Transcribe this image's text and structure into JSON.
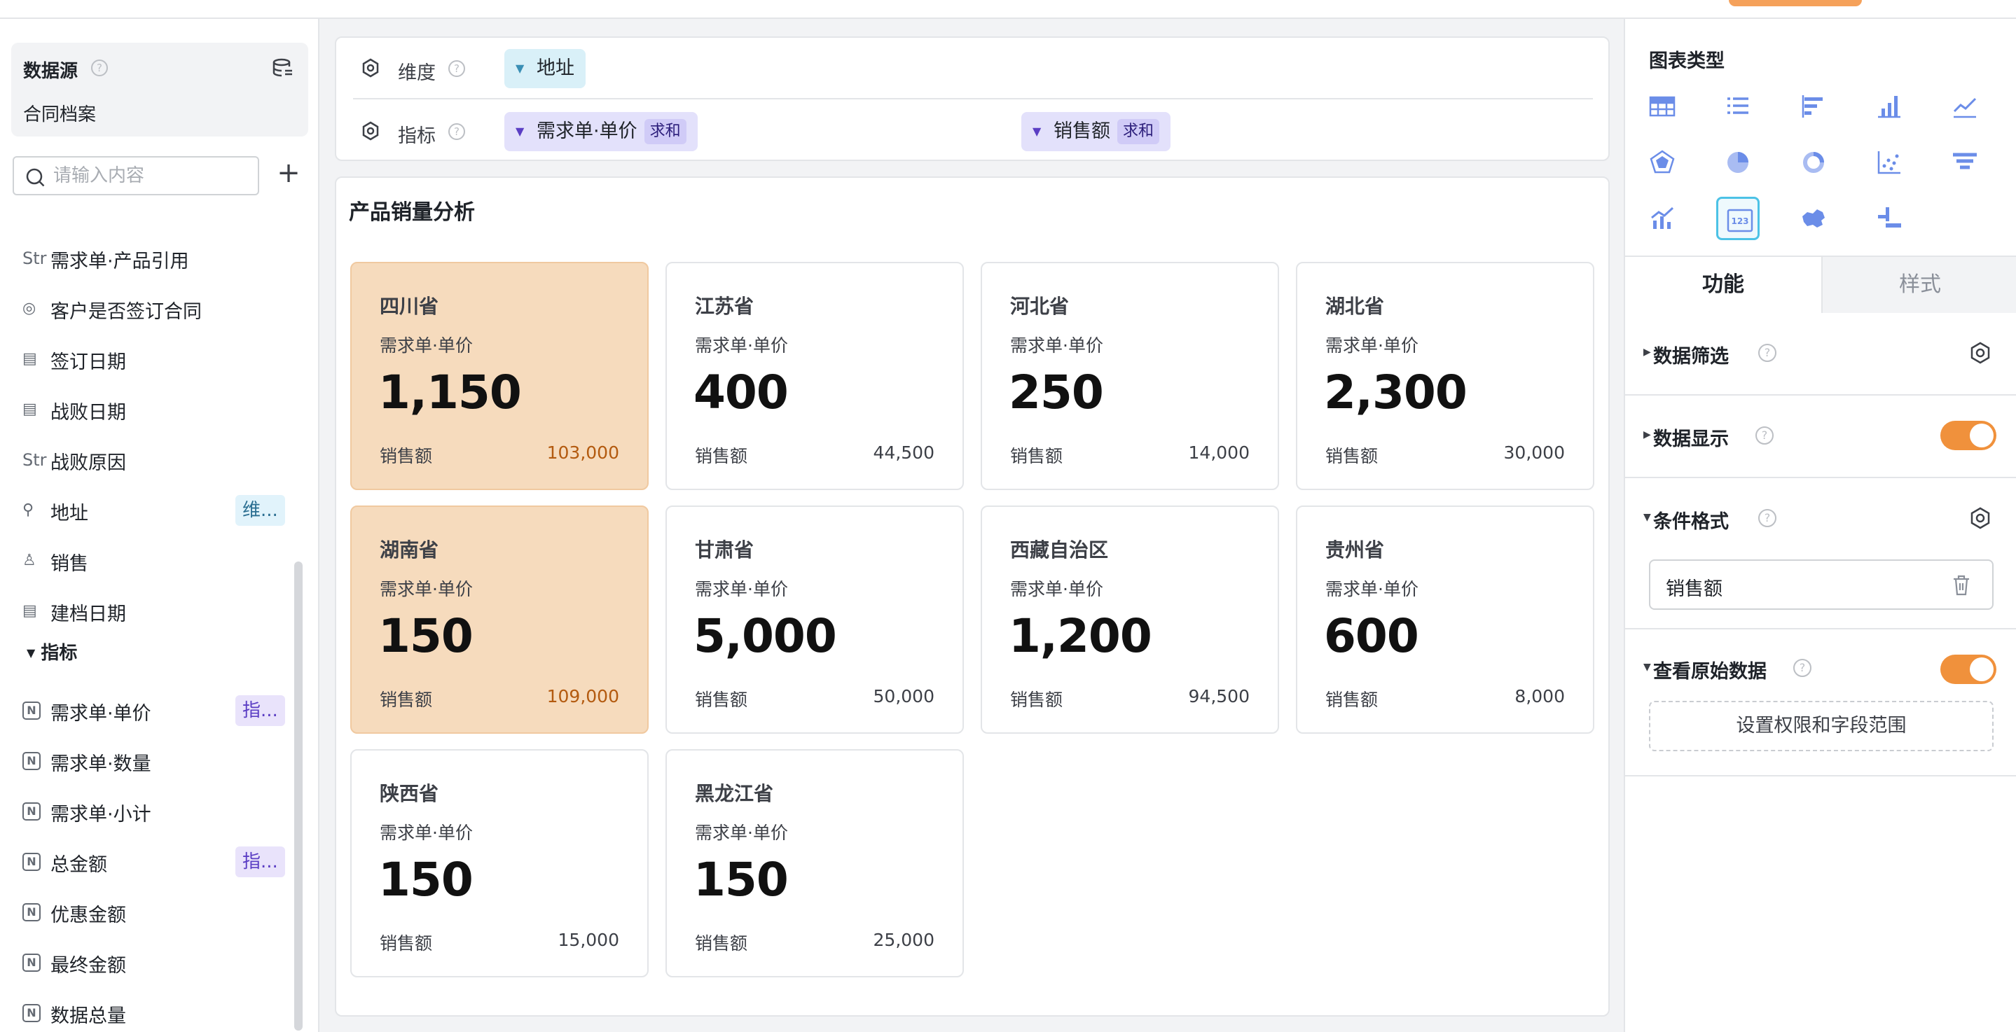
{
  "datasource": {
    "title": "数据源",
    "help": "?",
    "name": "合同档案"
  },
  "search": {
    "placeholder": "请输入内容",
    "add": "+"
  },
  "fields": [
    {
      "icon": "Str",
      "label": "需求单·产品引用",
      "tag": ""
    },
    {
      "icon": "◎",
      "label": "客户是否签订合同",
      "tag": ""
    },
    {
      "icon": "▤",
      "label": "签订日期",
      "tag": ""
    },
    {
      "icon": "▤",
      "label": "战败日期",
      "tag": ""
    },
    {
      "icon": "Str",
      "label": "战败原因",
      "tag": ""
    },
    {
      "icon": "⚲",
      "label": "地址",
      "tag": "维..."
    },
    {
      "icon": "♙",
      "label": "销售",
      "tag": ""
    },
    {
      "icon": "▤",
      "label": "建档日期",
      "tag": ""
    }
  ],
  "measures_section": "指标",
  "measures": [
    {
      "icon": "N",
      "label": "需求单·单价",
      "tag": "指..."
    },
    {
      "icon": "N",
      "label": "需求单·数量",
      "tag": ""
    },
    {
      "icon": "N",
      "label": "需求单·小计",
      "tag": ""
    },
    {
      "icon": "N",
      "label": "总金额",
      "tag": "指..."
    },
    {
      "icon": "N",
      "label": "优惠金额",
      "tag": ""
    },
    {
      "icon": "N",
      "label": "最终金额",
      "tag": ""
    },
    {
      "icon": "N",
      "label": "数据总量",
      "tag": ""
    }
  ],
  "config": {
    "dimension_label": "维度",
    "measure_label": "指标",
    "help": "?",
    "dimension_pill": "地址",
    "measure_pills": [
      {
        "name": "需求单·单价",
        "agg": "求和"
      },
      {
        "name": "销售额",
        "agg": "求和"
      }
    ]
  },
  "chart_data": {
    "type": "table",
    "title": "产品销量分析",
    "metric_label": "需求单·单价",
    "sub_label": "销售额",
    "cards": [
      {
        "province": "四川省",
        "value": "1,150",
        "sales": "103,000",
        "highlight": true
      },
      {
        "province": "江苏省",
        "value": "400",
        "sales": "44,500",
        "highlight": false
      },
      {
        "province": "河北省",
        "value": "250",
        "sales": "14,000",
        "highlight": false
      },
      {
        "province": "湖北省",
        "value": "2,300",
        "sales": "30,000",
        "highlight": false
      },
      {
        "province": "湖南省",
        "value": "150",
        "sales": "109,000",
        "highlight": true
      },
      {
        "province": "甘肃省",
        "value": "5,000",
        "sales": "50,000",
        "highlight": false
      },
      {
        "province": "西藏自治区",
        "value": "1,200",
        "sales": "94,500",
        "highlight": false
      },
      {
        "province": "贵州省",
        "value": "600",
        "sales": "8,000",
        "highlight": false
      },
      {
        "province": "陕西省",
        "value": "150",
        "sales": "15,000",
        "highlight": false
      },
      {
        "province": "黑龙江省",
        "value": "150",
        "sales": "25,000",
        "highlight": false
      }
    ]
  },
  "right_panel": {
    "chart_types_title": "图表类型",
    "chart_types": [
      "table-icon",
      "list-icon",
      "bar-horizontal-icon",
      "bar-vertical-icon",
      "line-icon",
      "radar-icon",
      "pie-icon",
      "donut-icon",
      "scatter-icon",
      "funnel-icon",
      "combo-icon",
      "indicator-card-icon",
      "map-icon",
      "waterfall-icon"
    ],
    "selected_type": "indicator-card-icon",
    "tabs": [
      "功能",
      "样式"
    ],
    "options": {
      "data_filter": "数据筛选",
      "data_display": "数据显示",
      "conditional_format": "条件格式",
      "conditional_field": "销售额",
      "view_raw": "查看原始数据",
      "permission_button": "设置权限和字段范围"
    },
    "accent": "#f0913c"
  }
}
